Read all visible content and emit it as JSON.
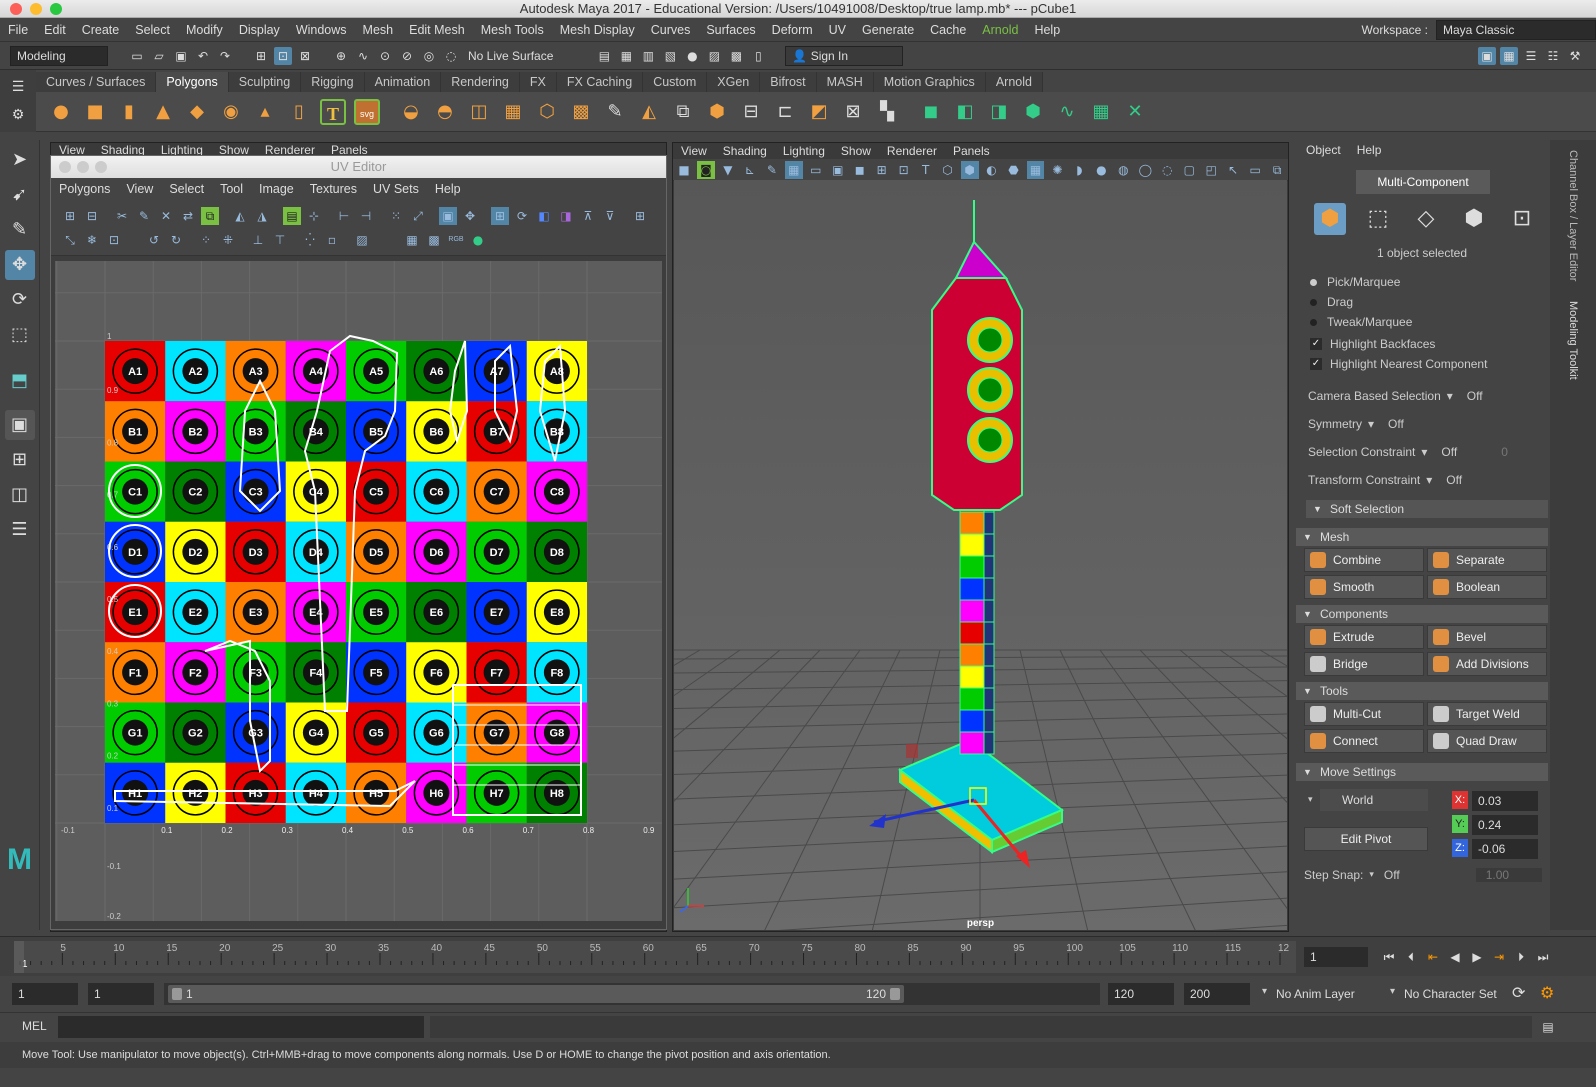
{
  "window": {
    "title": "Autodesk Maya 2017 - Educational Version: /Users/10491008/Desktop/true lamp.mb*   ---   pCube1"
  },
  "menubar": {
    "items": [
      "File",
      "Edit",
      "Create",
      "Select",
      "Modify",
      "Display",
      "Windows",
      "Mesh",
      "Edit Mesh",
      "Mesh Tools",
      "Mesh Display",
      "Curves",
      "Surfaces",
      "Deform",
      "UV",
      "Generate",
      "Cache",
      "Arnold",
      "Help"
    ],
    "workspace_label": "Workspace :",
    "workspace_value": "Maya Classic"
  },
  "statusline": {
    "mode": "Modeling",
    "live_surface": "No Live Surface",
    "sign_in": "Sign In"
  },
  "shelf": {
    "tabs": [
      "Curves / Surfaces",
      "Polygons",
      "Sculpting",
      "Rigging",
      "Animation",
      "Rendering",
      "FX",
      "FX Caching",
      "Custom",
      "XGen",
      "Bifrost",
      "MASH",
      "Motion Graphics",
      "Arnold"
    ],
    "active_tab": "Polygons"
  },
  "uv_panel_menu": [
    "View",
    "Shading",
    "Lighting",
    "Show",
    "Renderer",
    "Panels"
  ],
  "uv_editor": {
    "title": "UV Editor",
    "menu": [
      "Polygons",
      "View",
      "Select",
      "Tool",
      "Image",
      "Textures",
      "UV Sets",
      "Help"
    ],
    "axis_labels": [
      "1",
      "0.9",
      "0.8",
      "0.7",
      "0.6",
      "0.5",
      "0.4",
      "0.3",
      "0.2",
      "0.1",
      "-0.1",
      "0.1",
      "0.2",
      "0.3",
      "0.4",
      "0.5",
      "0.6",
      "0.7",
      "0.8",
      "0.9",
      "-0.1",
      "-0.2"
    ],
    "grid_rows": [
      "A",
      "B",
      "C",
      "D",
      "E",
      "F",
      "G",
      "H"
    ],
    "grid_cols": [
      "1",
      "2",
      "3",
      "4",
      "5",
      "6",
      "7",
      "8"
    ]
  },
  "viewport": {
    "menu": [
      "View",
      "Shading",
      "Lighting",
      "Show",
      "Renderer",
      "Panels"
    ],
    "camera_label": "persp"
  },
  "modeling_toolkit": {
    "menu": [
      "Object",
      "Help"
    ],
    "mode": "Multi-Component",
    "selection_count": "1 object selected",
    "pick_options": [
      "Pick/Marquee",
      "Drag",
      "Tweak/Marquee"
    ],
    "checkboxes": [
      "Highlight Backfaces",
      "Highlight Nearest Component"
    ],
    "camera_based_selection": {
      "label": "Camera Based Selection",
      "value": "Off"
    },
    "symmetry": {
      "label": "Symmetry",
      "value": "Off"
    },
    "selection_constraint": {
      "label": "Selection Constraint",
      "value": "Off",
      "amount": "0"
    },
    "transform_constraint": {
      "label": "Transform Constraint",
      "value": "Off"
    },
    "soft_selection": "Soft Selection",
    "mesh_section": "Mesh",
    "mesh_buttons": [
      "Combine",
      "Separate",
      "Smooth",
      "Boolean"
    ],
    "components_section": "Components",
    "component_buttons": [
      "Extrude",
      "Bevel",
      "Bridge",
      "Add Divisions"
    ],
    "tools_section": "Tools",
    "tool_buttons": [
      "Multi-Cut",
      "Target Weld",
      "Connect",
      "Quad Draw"
    ],
    "move_settings": "Move Settings",
    "space": "World",
    "x": "0.03",
    "y": "0.24",
    "z": "-0.06",
    "edit_pivot": "Edit Pivot",
    "step_snap_label": "Step Snap:",
    "step_snap_value": "Off",
    "step_snap_amount": "1.00"
  },
  "side_tabs": [
    "Channel Box / Layer Editor",
    "Modeling Toolkit"
  ],
  "timeline": {
    "ticks": [
      "1",
      "5",
      "10",
      "15",
      "20",
      "25",
      "30",
      "35",
      "40",
      "45",
      "50",
      "55",
      "60",
      "65",
      "70",
      "75",
      "80",
      "85",
      "90",
      "95",
      "100",
      "105",
      "110",
      "115",
      "12"
    ],
    "current_frame": "1"
  },
  "range": {
    "start": "1",
    "playback_start": "1",
    "slider_start": "1",
    "slider_end": "120",
    "playback_end": "120",
    "end": "200",
    "anim_layer": "No Anim Layer",
    "character_set": "No Character Set"
  },
  "command_line": {
    "label": "MEL"
  },
  "help_line": "Move Tool: Use manipulator to move object(s). Ctrl+MMB+drag to move components along normals. Use D or HOME to change the pivot position and axis orientation.",
  "colors": {
    "accent_blue": "#5285a6",
    "panel": "#444444",
    "active_button": "#6c9ec5"
  }
}
